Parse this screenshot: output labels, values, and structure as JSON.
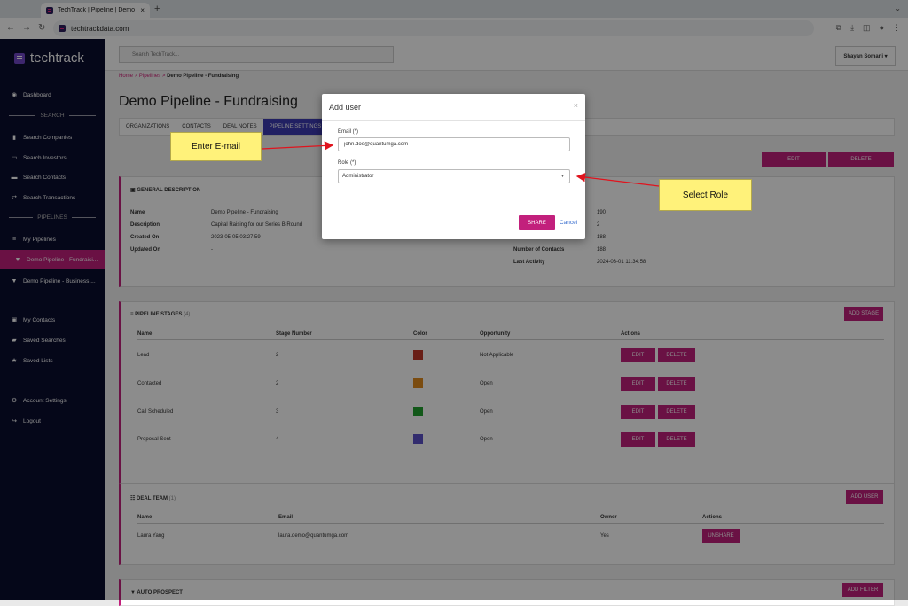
{
  "browser": {
    "tab_title": "TechTrack | Pipeline | Demo Pi",
    "tab_close": "×",
    "new_tab": "+",
    "url": "techtrackdata.com"
  },
  "sidebar": {
    "logo": "techtrack",
    "items": [
      {
        "label": "Dashboard",
        "icon": "dashboard-icon",
        "glyph": "◉"
      },
      {
        "label": "Search Companies",
        "icon": "building-icon",
        "glyph": "▮"
      },
      {
        "label": "Search Investors",
        "icon": "investor-icon",
        "glyph": "▭"
      },
      {
        "label": "Search Contacts",
        "icon": "contacts-icon",
        "glyph": "▬"
      },
      {
        "label": "Search Transactions",
        "icon": "exchange-icon",
        "glyph": "⇄"
      },
      {
        "label": "My Pipelines",
        "icon": "list-icon",
        "glyph": "≡"
      },
      {
        "label": "Demo Pipeline - Fundraisi...",
        "icon": "funnel-icon",
        "glyph": "▼"
      },
      {
        "label": "Demo Pipeline - Business ...",
        "icon": "funnel-icon",
        "glyph": "▼"
      },
      {
        "label": "My Contacts",
        "icon": "addressbook-icon",
        "glyph": "▣"
      },
      {
        "label": "Saved Searches",
        "icon": "bookmark-icon",
        "glyph": "▰"
      },
      {
        "label": "Saved Lists",
        "icon": "star-icon",
        "glyph": "★"
      },
      {
        "label": "Account Settings",
        "icon": "gear-icon",
        "glyph": "⚙"
      },
      {
        "label": "Logout",
        "icon": "logout-icon",
        "glyph": "↪"
      }
    ],
    "section_search": "SEARCH",
    "section_pipelines": "PIPELINES"
  },
  "header": {
    "search_placeholder": "Search TechTrack...",
    "user": "Shayan Somani ▾"
  },
  "breadcrumb": {
    "home": "Home",
    "sep": ">",
    "pipelines": "Pipelines",
    "current": "Demo Pipeline - Fundraising"
  },
  "page_title": "Demo Pipeline - Fundraising",
  "tabs": [
    "ORGANIZATIONS",
    "CONTACTS",
    "DEAL NOTES",
    "PIPELINE SETTINGS"
  ],
  "actions": {
    "edit": "EDIT",
    "delete": "DELETE"
  },
  "general": {
    "heading": "GENERAL DESCRIPTION",
    "left": [
      {
        "k": "Name",
        "v": "Demo Pipeline - Fundraising"
      },
      {
        "k": "Description",
        "v": "Capital Raising for our Series B Round"
      },
      {
        "k": "Created On",
        "v": "2023-05-05 03:27:59"
      },
      {
        "k": "Updated On",
        "v": "-"
      }
    ],
    "right_values": [
      "190",
      "2",
      "188"
    ],
    "right": [
      {
        "k": "Number of Contacts",
        "v": "188"
      },
      {
        "k": "Last Activity",
        "v": "2024-03-01 11:34:58"
      }
    ]
  },
  "stages": {
    "heading": "PIPELINE STAGES",
    "count": "(4)",
    "add": "ADD STAGE",
    "columns": [
      "Name",
      "Stage Number",
      "Color",
      "Opportunity",
      "Actions"
    ],
    "rows": [
      {
        "name": "Lead",
        "num": "2",
        "color": "#c0392b",
        "opp": "Not Applicable"
      },
      {
        "name": "Contacted",
        "num": "2",
        "color": "#e08a1e",
        "opp": "Open"
      },
      {
        "name": "Call Scheduled",
        "num": "3",
        "color": "#22a12f",
        "opp": "Open"
      },
      {
        "name": "Proposal Sent",
        "num": "4",
        "color": "#5b50c8",
        "opp": "Open"
      }
    ],
    "edit": "EDIT",
    "delete": "DELETE"
  },
  "team": {
    "heading": "DEAL TEAM",
    "count": "(1)",
    "add": "ADD USER",
    "columns": [
      "Name",
      "Email",
      "Owner",
      "Actions"
    ],
    "rows": [
      {
        "name": "Laura Yang",
        "email": "laura.demo@quantumga.com",
        "owner": "Yes"
      }
    ],
    "unshare": "UNSHARE"
  },
  "autoprospect": {
    "heading": "AUTO PROSPECT",
    "add": "ADD FILTER"
  },
  "modal": {
    "title": "Add user",
    "close": "×",
    "email_label": "Email (*)",
    "email_value": "john.doe@quantumga.com",
    "role_label": "Role (*)",
    "role_value": "Administrator",
    "share": "SHARE",
    "cancel": "Cancel"
  },
  "annotations": {
    "email": "Enter E-mail",
    "role": "Select Role"
  },
  "colors": {
    "accent": "#c2207c",
    "sidebar": "#0a0d2e",
    "tab_active": "#3d3bb3",
    "callout": "#fff27a",
    "arrow": "#e0141e"
  }
}
